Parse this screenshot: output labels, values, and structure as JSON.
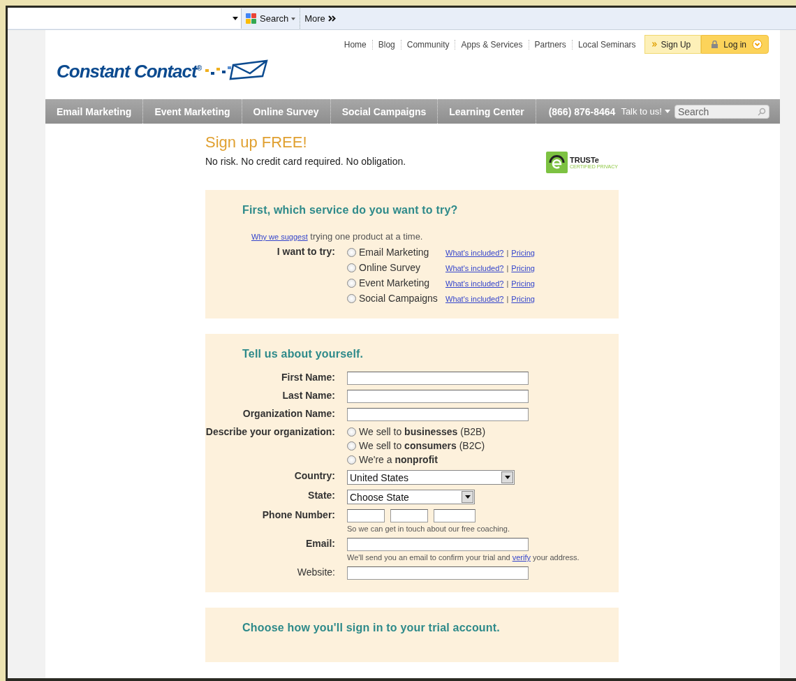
{
  "browser_toolbar": {
    "search_label": "Search",
    "more_label": "More"
  },
  "header": {
    "logo": "Constant Contact$^{®}$",
    "top_links": [
      "Home",
      "Blog",
      "Community",
      "Apps & Services",
      "Partners",
      "Local Seminars"
    ],
    "sign_up": "Sign Up",
    "log_in": "Log in"
  },
  "nav": {
    "items": [
      "Email Marketing",
      "Event Marketing",
      "Online Survey",
      "Social Campaigns",
      "Learning Center"
    ],
    "phone": "(866) 876-8464",
    "talk": "Talk to us!",
    "search": {
      "placeholder": "Search"
    }
  },
  "intro": {
    "title": "Sign up FREE!",
    "subtitle": "No risk. No credit card required. No obligation.",
    "badge": {
      "name": "TRUSTe",
      "caption": "CERTIFIED PRIVACY"
    }
  },
  "service_section": {
    "heading": "First, which service do you want to try?",
    "note_link": "Why we suggest",
    "note_text": "trying one product at a time.",
    "try_label": "I want to try:",
    "options": [
      {
        "label": "Email Marketing",
        "selected": false,
        "info_link": "What's included?",
        "separator": "|",
        "pricing_link": "Pricing"
      },
      {
        "label": "Online Survey",
        "selected": false,
        "info_link": "What's included?",
        "separator": "|",
        "pricing_link": "Pricing"
      },
      {
        "label": "Event Marketing",
        "selected": false,
        "info_link": "What's included?",
        "separator": "|",
        "pricing_link": "Pricing"
      },
      {
        "label": "Social Campaigns",
        "selected": false,
        "info_link": "What's included?",
        "separator": "|",
        "pricing_link": "Pricing"
      }
    ]
  },
  "about_section": {
    "heading": "Tell us about yourself.",
    "rows": [
      {
        "kind": "text",
        "label": "First Name:",
        "bold": true
      },
      {
        "kind": "text",
        "label": "Last Name:",
        "bold": true
      },
      {
        "kind": "text",
        "label": "Organization Name:",
        "bold": true
      },
      {
        "kind": "radios",
        "label": "Describe your organization:",
        "bold": true,
        "options": [
          {
            "label": "We sell to **businesses** (B2B)",
            "selected": false
          },
          {
            "label": "We sell to **consumers** (B2C)",
            "selected": false
          },
          {
            "label": "We're a **nonprofit**",
            "selected": false
          }
        ]
      },
      {
        "kind": "select",
        "label": "Country:",
        "bold": true,
        "value": "United States"
      },
      {
        "kind": "select",
        "label": "State:",
        "bold": true,
        "value": "Choose State"
      },
      {
        "kind": "phone",
        "label": "Phone Number:",
        "bold": true,
        "hint": {
          "before": "So we can get in touch about our free coaching."
        }
      },
      {
        "kind": "text",
        "label": "Email:",
        "bold": true,
        "hint": {
          "before": "We'll send you an email to confirm your trial and",
          "link": "verify",
          "after": "your address."
        }
      },
      {
        "kind": "text",
        "label": "Website:",
        "bold": false
      }
    ]
  },
  "signin_section": {
    "heading": "Choose how you'll sign in to your trial account."
  }
}
